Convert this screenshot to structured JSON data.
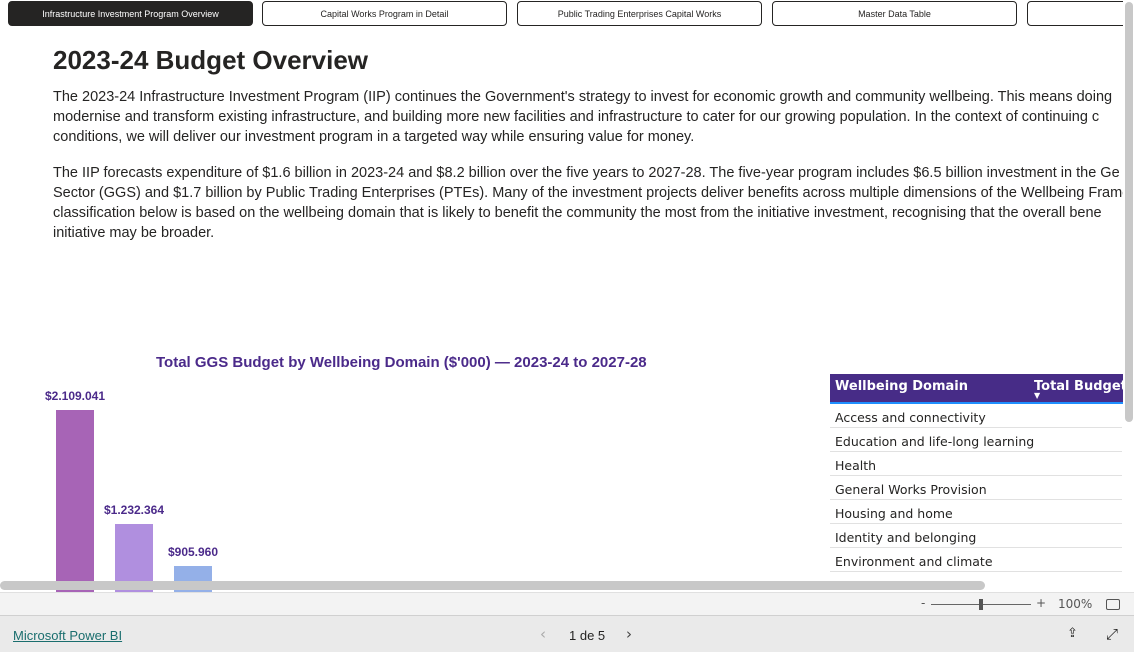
{
  "tabs": [
    {
      "label": "Infrastructure Investment Program Overview",
      "active": true
    },
    {
      "label": "Capital Works Program in Detail"
    },
    {
      "label": "Public Trading Enterprises Capital Works"
    },
    {
      "label": "Master Data Table"
    },
    {
      "label": ""
    }
  ],
  "page_title": "2023-24 Budget Overview",
  "paragraph1": [
    "The 2023-24 Infrastructure Investment Program (IIP) continues the Government's strategy to invest for economic growth and community wellbeing. This means doing",
    "modernise and transform existing infrastructure, and building more new facilities and infrastructure to cater for our growing population. In the context of continuing c",
    "conditions, we will deliver our investment program in a targeted way while ensuring value for money."
  ],
  "paragraph2": [
    "The IIP forecasts expenditure of $1.6 billion in 2023-24 and $8.2 billion over the five years to 2027-28. The five-year program includes $6.5 billion investment in the Ge",
    "Sector (GGS) and $1.7 billion by Public Trading Enterprises (PTEs). Many of the investment projects deliver benefits across multiple dimensions of the Wellbeing Frame",
    "classification below is based on the wellbeing domain that is likely to benefit the community the most from the initiative investment, recognising that the overall bene",
    "initiative may be broader."
  ],
  "chart_data": {
    "type": "bar",
    "title": "Total GGS Budget by Wellbeing Domain ($'000) — 2023-24 to 2027-28",
    "values": [
      2109041,
      1232364,
      905960
    ],
    "labels": [
      "$2.109.041",
      "$1.232.364",
      "$905.960"
    ],
    "colors": [
      "#a764b6",
      "#b08fdf",
      "#94b0e8"
    ]
  },
  "table": {
    "headers": [
      "Wellbeing Domain",
      "Total Budgete"
    ],
    "rows": [
      "Access and connectivity",
      "Education and life-long learning",
      "Health",
      "General Works Provision",
      "Housing and home",
      "Identity and belonging",
      "Environment and climate"
    ],
    "header_color": "#472c87"
  },
  "zoom": {
    "minus": "-",
    "plus": "+",
    "level": "100%",
    "value_percent": 100
  },
  "footer": {
    "brand": "Microsoft Power BI",
    "page": "1 de 5"
  }
}
